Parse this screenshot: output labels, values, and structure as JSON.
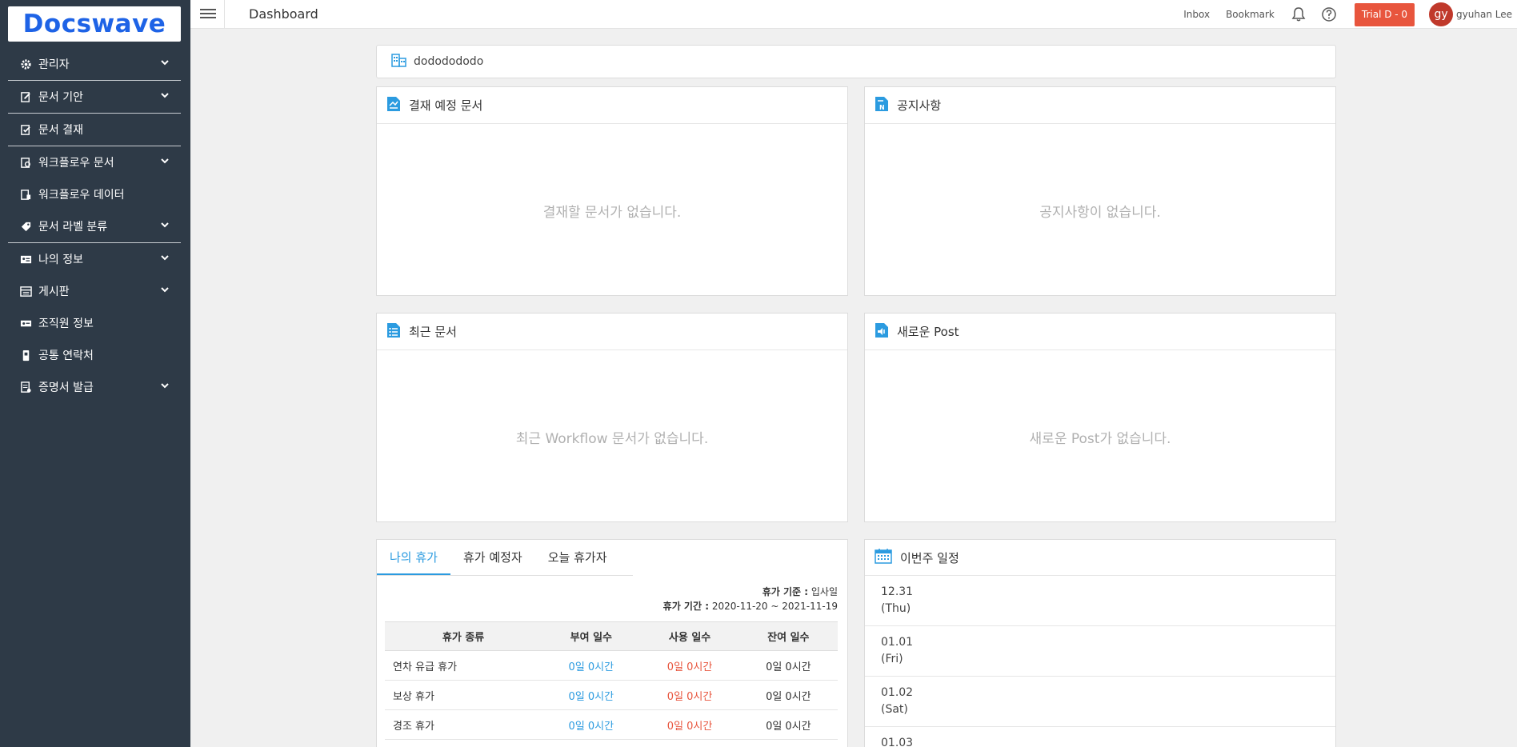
{
  "logo": "Docswave",
  "sidebar": {
    "items": [
      {
        "label": "관리자"
      },
      {
        "label": "문서 기안"
      },
      {
        "label": "문서 결재"
      },
      {
        "label": "워크플로우 문서"
      },
      {
        "label": "워크플로우 데이터"
      },
      {
        "label": "문서 라벨 분류"
      },
      {
        "label": "나의 정보"
      },
      {
        "label": "게시판"
      },
      {
        "label": "조직원 정보"
      },
      {
        "label": "공통 연락처"
      },
      {
        "label": "증명서 발급"
      }
    ]
  },
  "topbar": {
    "title": "Dashboard",
    "inbox": "Inbox",
    "bookmark": "Bookmark",
    "trial": "Trial D - 0",
    "avatar": "gy",
    "username": "gyuhan Lee"
  },
  "company": {
    "name": "dododododo"
  },
  "panels": {
    "approval": {
      "title": "결재 예정 문서",
      "empty": "결재할 문서가 없습니다."
    },
    "notice": {
      "title": "공지사항",
      "empty": "공지사항이 없습니다."
    },
    "recent": {
      "title": "최근 문서",
      "empty": "최근 Workflow 문서가 없습니다."
    },
    "newpost": {
      "title": "새로운 Post",
      "empty": "새로운 Post가 없습니다."
    }
  },
  "vacation": {
    "tabs": [
      "나의 휴가",
      "휴가 예정자",
      "오늘 휴가자"
    ],
    "basis_label": "휴가 기준 :",
    "basis_value": "입사일",
    "period_label": "휴가 기간 :",
    "period_value": "2020-11-20 ~ 2021-11-19",
    "columns": [
      "휴가 종류",
      "부여 일수",
      "사용 일수",
      "잔여 일수"
    ],
    "rows": [
      [
        "연차 유급 휴가",
        "0일 0시간",
        "0일 0시간",
        "0일 0시간"
      ],
      [
        "보상 휴가",
        "0일 0시간",
        "0일 0시간",
        "0일 0시간"
      ],
      [
        "경조 휴가",
        "0일 0시간",
        "0일 0시간",
        "0일 0시간"
      ]
    ]
  },
  "schedule": {
    "title": "이번주 일정",
    "days": [
      {
        "date": "12.31",
        "dow": "(Thu)"
      },
      {
        "date": "01.01",
        "dow": "(Fri)"
      },
      {
        "date": "01.02",
        "dow": "(Sat)"
      },
      {
        "date": "01.03",
        "dow": ""
      }
    ]
  }
}
